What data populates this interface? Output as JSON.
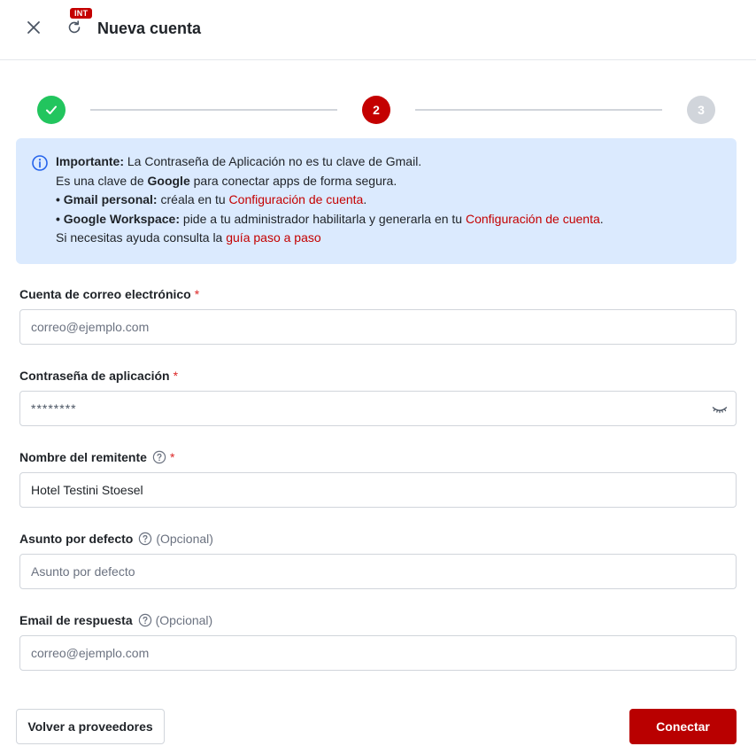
{
  "header": {
    "title": "Nueva cuenta",
    "env_badge": "INT",
    "close_icon": "close-icon",
    "refresh_icon": "refresh-icon"
  },
  "stepper": {
    "steps": [
      {
        "state": "completed",
        "icon": "check-icon"
      },
      {
        "label": "2",
        "state": "active"
      },
      {
        "label": "3",
        "state": "pending"
      }
    ]
  },
  "info": {
    "line1_bold": "Importante:",
    "line1_rest": " La Contraseña de Aplicación no es tu clave de Gmail.",
    "line2_pre": "Es una clave de ",
    "line2_bold": "Google",
    "line2_post": " para conectar apps de forma segura.",
    "line3_bold": "• Gmail personal:",
    "line3_text": " créala en tu ",
    "line3_link": "Configuración de cuenta",
    "line3_end": ".",
    "line4_bold": "• Google Workspace:",
    "line4_text": " pide a tu administrador habilitarla y generarla en tu ",
    "line4_link": "Configuración de cuenta",
    "line4_end": ".",
    "line5_text": "Si necesitas ayuda consulta la ",
    "line5_link": "guía paso a paso"
  },
  "form": {
    "email": {
      "label": "Cuenta de correo electrónico",
      "required": "*",
      "placeholder": "correo@ejemplo.com",
      "value": ""
    },
    "password": {
      "label": "Contraseña de aplicación",
      "required": "*",
      "placeholder": "********",
      "value": ""
    },
    "sender": {
      "label": "Nombre del remitente",
      "required": "*",
      "placeholder": "",
      "value": "Hotel Testini Stoesel"
    },
    "subject": {
      "label": "Asunto por defecto",
      "optional": "(Opcional)",
      "placeholder": "Asunto por defecto",
      "value": ""
    },
    "reply_to": {
      "label": "Email de respuesta",
      "optional": "(Opcional)",
      "placeholder": "correo@ejemplo.com",
      "value": ""
    }
  },
  "footer": {
    "back_label": "Volver a proveedores",
    "connect_label": "Conectar"
  },
  "colors": {
    "brand": "#b90000",
    "success": "#22c55e",
    "info_bg": "#dbeafe",
    "required": "#dc2626"
  }
}
